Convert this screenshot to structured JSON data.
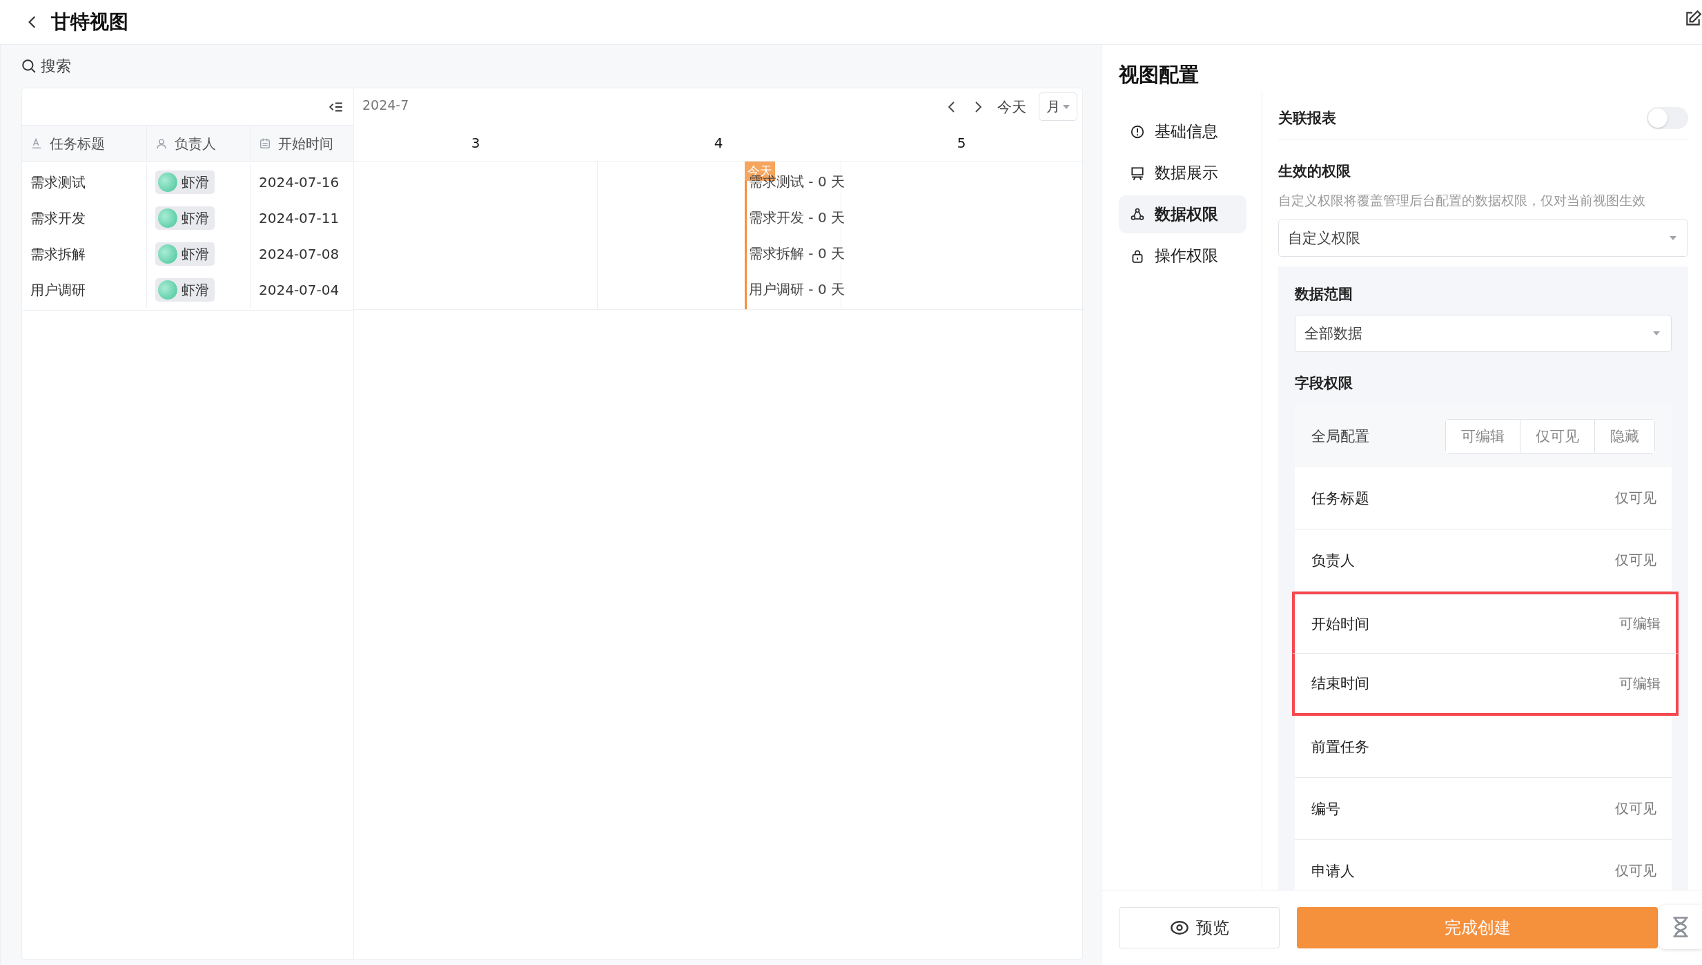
{
  "header": {
    "title": "甘特视图"
  },
  "search": {
    "placeholder": "搜索"
  },
  "gantt": {
    "month": "2024-7",
    "today_button": "今天",
    "scale": "月",
    "today_marker": "今天",
    "columns": [
      {
        "label": "任务标题",
        "kind": "text"
      },
      {
        "label": "负责人",
        "kind": "person"
      },
      {
        "label": "开始时间",
        "kind": "date"
      }
    ],
    "days": [
      {
        "label": "3",
        "today": false
      },
      {
        "label": "4",
        "today": true
      },
      {
        "label": "5",
        "today": false
      }
    ],
    "rows": [
      {
        "title": "需求测试",
        "owner": "虾滑",
        "start": "2024-07-16",
        "bar_label": "需求测试 - 0 天"
      },
      {
        "title": "需求开发",
        "owner": "虾滑",
        "start": "2024-07-11",
        "bar_label": "需求开发 - 0 天"
      },
      {
        "title": "需求拆解",
        "owner": "虾滑",
        "start": "2024-07-08",
        "bar_label": "需求拆解 - 0 天"
      },
      {
        "title": "用户调研",
        "owner": "虾滑",
        "start": "2024-07-04",
        "bar_label": "用户调研 - 0 天"
      }
    ]
  },
  "config": {
    "title": "视图配置",
    "nav": [
      {
        "label": "基础信息",
        "kind": "info",
        "selected": false
      },
      {
        "label": "数据展示",
        "kind": "display",
        "selected": false
      },
      {
        "label": "数据权限",
        "kind": "data",
        "selected": true
      },
      {
        "label": "操作权限",
        "kind": "lock",
        "selected": false
      }
    ],
    "linked_report": {
      "label": "关联报表",
      "on": false
    },
    "permission": {
      "title": "生效的权限",
      "description": "自定义权限将覆盖管理后台配置的数据权限，仅对当前视图生效",
      "value": "自定义权限"
    },
    "data_scope": {
      "title": "数据范围",
      "value": "全部数据"
    },
    "field_permissions": {
      "title": "字段权限",
      "global_label": "全局配置",
      "options": [
        "可编辑",
        "仅可见",
        "隐藏"
      ],
      "fields": [
        {
          "name": "任务标题",
          "value": "仅可见",
          "highlighted": false
        },
        {
          "name": "负责人",
          "value": "仅可见",
          "highlighted": false
        },
        {
          "name": "开始时间",
          "value": "可编辑",
          "highlighted": true
        },
        {
          "name": "结束时间",
          "value": "可编辑",
          "highlighted": true
        },
        {
          "name": "前置任务",
          "highlighted": false
        },
        {
          "name": "编号",
          "value": "仅可见",
          "highlighted": false
        },
        {
          "name": "申请人",
          "value": "仅可见",
          "highlighted": false
        }
      ]
    },
    "footer": {
      "preview": "预览",
      "finish": "完成创建"
    }
  }
}
